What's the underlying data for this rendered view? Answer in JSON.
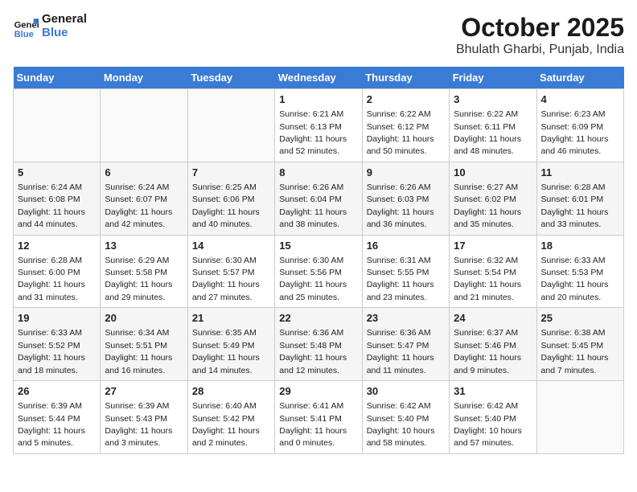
{
  "header": {
    "logo_line1": "General",
    "logo_line2": "Blue",
    "title": "October 2025",
    "subtitle": "Bhulath Gharbi, Punjab, India"
  },
  "days_of_week": [
    "Sunday",
    "Monday",
    "Tuesday",
    "Wednesday",
    "Thursday",
    "Friday",
    "Saturday"
  ],
  "weeks": [
    [
      {
        "day": "",
        "info": ""
      },
      {
        "day": "",
        "info": ""
      },
      {
        "day": "",
        "info": ""
      },
      {
        "day": "1",
        "info": "Sunrise: 6:21 AM\nSunset: 6:13 PM\nDaylight: 11 hours\nand 52 minutes."
      },
      {
        "day": "2",
        "info": "Sunrise: 6:22 AM\nSunset: 6:12 PM\nDaylight: 11 hours\nand 50 minutes."
      },
      {
        "day": "3",
        "info": "Sunrise: 6:22 AM\nSunset: 6:11 PM\nDaylight: 11 hours\nand 48 minutes."
      },
      {
        "day": "4",
        "info": "Sunrise: 6:23 AM\nSunset: 6:09 PM\nDaylight: 11 hours\nand 46 minutes."
      }
    ],
    [
      {
        "day": "5",
        "info": "Sunrise: 6:24 AM\nSunset: 6:08 PM\nDaylight: 11 hours\nand 44 minutes."
      },
      {
        "day": "6",
        "info": "Sunrise: 6:24 AM\nSunset: 6:07 PM\nDaylight: 11 hours\nand 42 minutes."
      },
      {
        "day": "7",
        "info": "Sunrise: 6:25 AM\nSunset: 6:06 PM\nDaylight: 11 hours\nand 40 minutes."
      },
      {
        "day": "8",
        "info": "Sunrise: 6:26 AM\nSunset: 6:04 PM\nDaylight: 11 hours\nand 38 minutes."
      },
      {
        "day": "9",
        "info": "Sunrise: 6:26 AM\nSunset: 6:03 PM\nDaylight: 11 hours\nand 36 minutes."
      },
      {
        "day": "10",
        "info": "Sunrise: 6:27 AM\nSunset: 6:02 PM\nDaylight: 11 hours\nand 35 minutes."
      },
      {
        "day": "11",
        "info": "Sunrise: 6:28 AM\nSunset: 6:01 PM\nDaylight: 11 hours\nand 33 minutes."
      }
    ],
    [
      {
        "day": "12",
        "info": "Sunrise: 6:28 AM\nSunset: 6:00 PM\nDaylight: 11 hours\nand 31 minutes."
      },
      {
        "day": "13",
        "info": "Sunrise: 6:29 AM\nSunset: 5:58 PM\nDaylight: 11 hours\nand 29 minutes."
      },
      {
        "day": "14",
        "info": "Sunrise: 6:30 AM\nSunset: 5:57 PM\nDaylight: 11 hours\nand 27 minutes."
      },
      {
        "day": "15",
        "info": "Sunrise: 6:30 AM\nSunset: 5:56 PM\nDaylight: 11 hours\nand 25 minutes."
      },
      {
        "day": "16",
        "info": "Sunrise: 6:31 AM\nSunset: 5:55 PM\nDaylight: 11 hours\nand 23 minutes."
      },
      {
        "day": "17",
        "info": "Sunrise: 6:32 AM\nSunset: 5:54 PM\nDaylight: 11 hours\nand 21 minutes."
      },
      {
        "day": "18",
        "info": "Sunrise: 6:33 AM\nSunset: 5:53 PM\nDaylight: 11 hours\nand 20 minutes."
      }
    ],
    [
      {
        "day": "19",
        "info": "Sunrise: 6:33 AM\nSunset: 5:52 PM\nDaylight: 11 hours\nand 18 minutes."
      },
      {
        "day": "20",
        "info": "Sunrise: 6:34 AM\nSunset: 5:51 PM\nDaylight: 11 hours\nand 16 minutes."
      },
      {
        "day": "21",
        "info": "Sunrise: 6:35 AM\nSunset: 5:49 PM\nDaylight: 11 hours\nand 14 minutes."
      },
      {
        "day": "22",
        "info": "Sunrise: 6:36 AM\nSunset: 5:48 PM\nDaylight: 11 hours\nand 12 minutes."
      },
      {
        "day": "23",
        "info": "Sunrise: 6:36 AM\nSunset: 5:47 PM\nDaylight: 11 hours\nand 11 minutes."
      },
      {
        "day": "24",
        "info": "Sunrise: 6:37 AM\nSunset: 5:46 PM\nDaylight: 11 hours\nand 9 minutes."
      },
      {
        "day": "25",
        "info": "Sunrise: 6:38 AM\nSunset: 5:45 PM\nDaylight: 11 hours\nand 7 minutes."
      }
    ],
    [
      {
        "day": "26",
        "info": "Sunrise: 6:39 AM\nSunset: 5:44 PM\nDaylight: 11 hours\nand 5 minutes."
      },
      {
        "day": "27",
        "info": "Sunrise: 6:39 AM\nSunset: 5:43 PM\nDaylight: 11 hours\nand 3 minutes."
      },
      {
        "day": "28",
        "info": "Sunrise: 6:40 AM\nSunset: 5:42 PM\nDaylight: 11 hours\nand 2 minutes."
      },
      {
        "day": "29",
        "info": "Sunrise: 6:41 AM\nSunset: 5:41 PM\nDaylight: 11 hours\nand 0 minutes."
      },
      {
        "day": "30",
        "info": "Sunrise: 6:42 AM\nSunset: 5:40 PM\nDaylight: 10 hours\nand 58 minutes."
      },
      {
        "day": "31",
        "info": "Sunrise: 6:42 AM\nSunset: 5:40 PM\nDaylight: 10 hours\nand 57 minutes."
      },
      {
        "day": "",
        "info": ""
      }
    ]
  ]
}
